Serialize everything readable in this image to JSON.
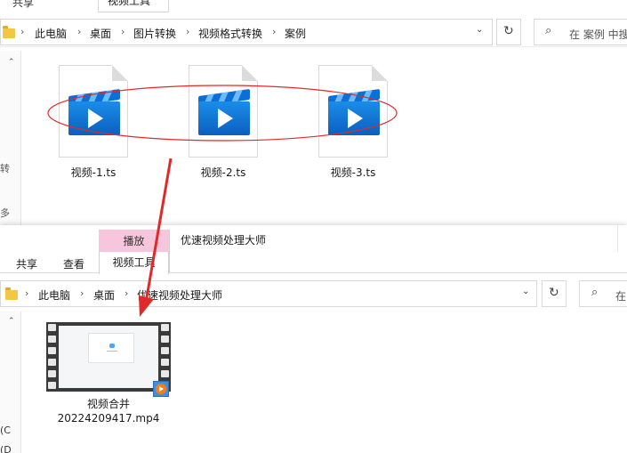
{
  "window_top": {
    "ribbon_tabs": [
      "共享",
      "视频工具"
    ],
    "breadcrumb": [
      "此电脑",
      "桌面",
      "图片转换",
      "视频格式转换",
      "案例"
    ],
    "search_placeholder": "在 案例 中搜",
    "files": [
      {
        "name": "视频-1.ts",
        "icon": "video-clapper-icon"
      },
      {
        "name": "视频-2.ts",
        "icon": "video-clapper-icon"
      },
      {
        "name": "视频-3.ts",
        "icon": "video-clapper-icon"
      }
    ],
    "left_strip_fragments": [
      "转",
      "多"
    ]
  },
  "window_bottom": {
    "context_group": "播放",
    "title": "优速视频处理大师",
    "ribbon_tabs": {
      "share": "共享",
      "view": "查看",
      "video_tools": "视频工具"
    },
    "breadcrumb": [
      "此电脑",
      "桌面",
      "优速视频处理大师"
    ],
    "search_placeholder": "在",
    "file": {
      "name_line1": "视频合并",
      "name_line2": "20224209417.mp4",
      "icon": "video-thumbnail-icon"
    },
    "left_strip_fragments": [
      "(C",
      "(D"
    ]
  },
  "icons": {
    "refresh": "refresh-icon",
    "search": "search-icon",
    "dropdown": "chevron-down-icon",
    "folder": "folder-icon",
    "annotation": "red-arrow"
  },
  "colors": {
    "annotation_red": "#e02a2a",
    "context_tab_pink": "#f7c6dd",
    "folder_yellow": "#f3c644",
    "clapper_blue": "#0b6fd8"
  }
}
